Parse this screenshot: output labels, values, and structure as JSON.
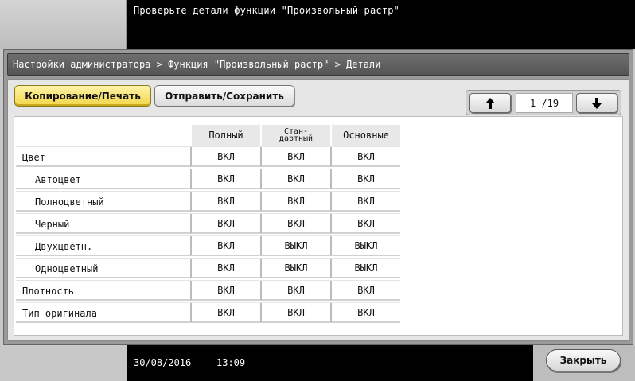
{
  "message": "Проверьте детали функции \"Произвольный растр\"",
  "breadcrumb": "Настройки администратора > Функция \"Произвольный растр\" > Детали",
  "tabs": [
    {
      "label": "Копирование/Печать",
      "active": true
    },
    {
      "label": "Отправить/Сохранить",
      "active": false
    }
  ],
  "pager": {
    "current": "1 /19",
    "up_icon": "arrow-up-icon",
    "down_icon": "arrow-down-icon"
  },
  "table": {
    "columns": [
      "Полный",
      "Стан-\nдартный",
      "Основные"
    ],
    "rows": [
      {
        "label": "Цвет",
        "indent": false,
        "values": [
          "ВКЛ",
          "ВКЛ",
          "ВКЛ"
        ]
      },
      {
        "label": "Автоцвет",
        "indent": true,
        "values": [
          "ВКЛ",
          "ВКЛ",
          "ВКЛ"
        ]
      },
      {
        "label": "Полноцветный",
        "indent": true,
        "values": [
          "ВКЛ",
          "ВКЛ",
          "ВКЛ"
        ]
      },
      {
        "label": "Черный",
        "indent": true,
        "values": [
          "ВКЛ",
          "ВКЛ",
          "ВКЛ"
        ]
      },
      {
        "label": "Двухцветн.",
        "indent": true,
        "values": [
          "ВКЛ",
          "ВЫКЛ",
          "ВЫКЛ"
        ]
      },
      {
        "label": "Одноцветный",
        "indent": true,
        "values": [
          "ВКЛ",
          "ВЫКЛ",
          "ВЫКЛ"
        ]
      },
      {
        "label": "Плотность",
        "indent": false,
        "values": [
          "ВКЛ",
          "ВКЛ",
          "ВКЛ"
        ]
      },
      {
        "label": "Тип оригинала",
        "indent": false,
        "values": [
          "ВКЛ",
          "ВКЛ",
          "ВКЛ"
        ]
      }
    ]
  },
  "status": {
    "date": "30/08/2016",
    "time": "13:09"
  },
  "close_label": "Закрыть",
  "colors": {
    "active_tab": "#f2d64a",
    "title_bar": "#5f5f5f",
    "status_bar": "#000000"
  }
}
